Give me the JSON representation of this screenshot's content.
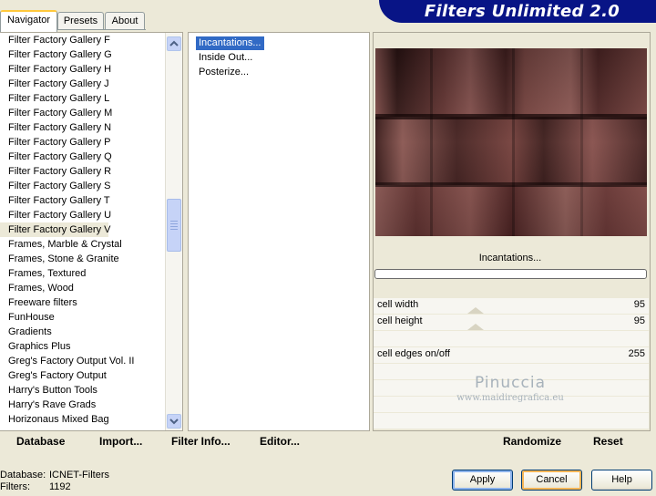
{
  "window_title": "Filters Unlimited 2.0",
  "tabs": [
    {
      "label": "Navigator",
      "active": true
    },
    {
      "label": "Presets",
      "active": false
    },
    {
      "label": "About",
      "active": false
    }
  ],
  "categories": [
    "Filter Factory Gallery F",
    "Filter Factory Gallery G",
    "Filter Factory Gallery H",
    "Filter Factory Gallery J",
    "Filter Factory Gallery L",
    "Filter Factory Gallery M",
    "Filter Factory Gallery N",
    "Filter Factory Gallery P",
    "Filter Factory Gallery Q",
    "Filter Factory Gallery R",
    "Filter Factory Gallery S",
    "Filter Factory Gallery T",
    "Filter Factory Gallery U",
    "Filter Factory Gallery V",
    "Frames, Marble & Crystal",
    "Frames, Stone & Granite",
    "Frames, Textured",
    "Frames, Wood",
    "Freeware filters",
    "FunHouse",
    "Gradients",
    "Graphics Plus",
    "Greg's Factory Output Vol. II",
    "Greg's Factory Output",
    "Harry's Button Tools",
    "Harry's Rave Grads",
    "Horizonaus Mixed Bag"
  ],
  "selected_category": "Filter Factory Gallery V",
  "filters": [
    "Incantations...",
    "Inside Out...",
    "Posterize..."
  ],
  "selected_filter": "Incantations...",
  "current_filter_name": "Incantations...",
  "controls": [
    {
      "label": "cell width",
      "value": "95"
    },
    {
      "label": "cell height",
      "value": "95"
    },
    {
      "label": "cell edges on/off",
      "value": "255"
    }
  ],
  "watermark": {
    "line1": "Pinuccia",
    "line2": "www.maidiregrafica.eu"
  },
  "bottom_links": {
    "database": "Database",
    "import": "Import...",
    "filter_info": "Filter Info...",
    "editor": "Editor...",
    "randomize": "Randomize",
    "reset": "Reset"
  },
  "status": {
    "database_label": "Database:",
    "database_value": "ICNET-Filters",
    "filters_label": "Filters:",
    "filters_value": "1192"
  },
  "buttons": {
    "apply": "Apply",
    "cancel": "Cancel",
    "help": "Help"
  },
  "colors": {
    "banner": "#081486",
    "selection": "#316ac5",
    "preview_dark": "#1a0c0c",
    "preview_mid": "#8a5550"
  },
  "icons": {
    "scroll_up": "chevron-up-icon",
    "scroll_down": "chevron-down-icon"
  }
}
